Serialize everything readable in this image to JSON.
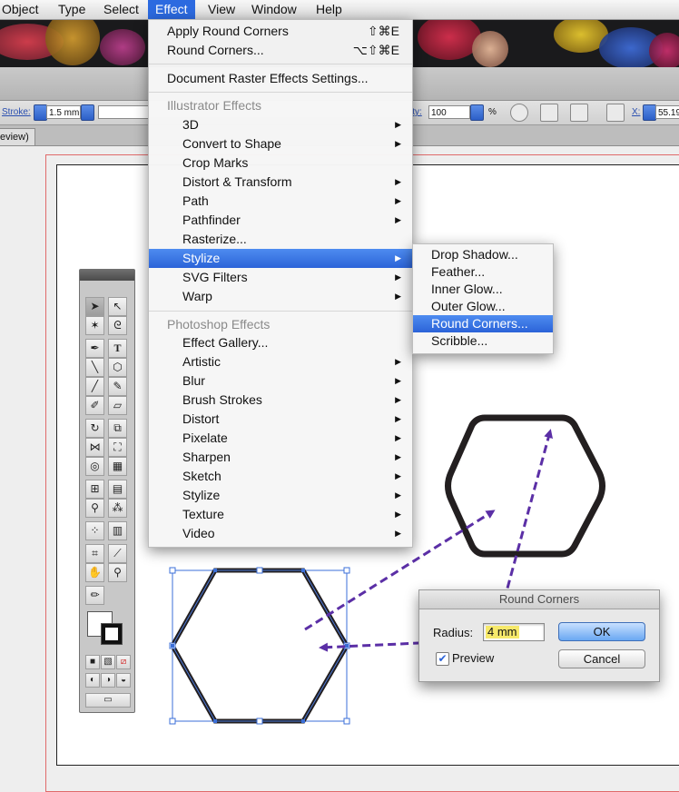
{
  "menubar": {
    "items": [
      "Object",
      "Type",
      "Select",
      "Effect",
      "View",
      "Window",
      "Help"
    ],
    "active": "Effect"
  },
  "control_bar": {
    "stroke_label": "Stroke:",
    "stroke_value": "1.5 mm",
    "opacity_label": "ity:",
    "opacity_value": "100",
    "opacity_unit": "%",
    "x_label": "X:",
    "x_value": "55.19"
  },
  "document_tab": {
    "label": "eview)"
  },
  "effect_menu": {
    "apply_round_corners": {
      "label": "Apply Round Corners",
      "shortcut": "⇧⌘E"
    },
    "round_corners": {
      "label": "Round Corners...",
      "shortcut": "⌥⇧⌘E"
    },
    "document_raster": "Document Raster Effects Settings...",
    "illustrator_header": "Illustrator Effects",
    "illustrator_items": [
      "3D",
      "Convert to Shape",
      "Crop Marks",
      "Distort & Transform",
      "Path",
      "Pathfinder",
      "Rasterize...",
      "Stylize",
      "SVG Filters",
      "Warp"
    ],
    "photoshop_header": "Photoshop Effects",
    "photoshop_items": [
      "Effect Gallery...",
      "Artistic",
      "Blur",
      "Brush Strokes",
      "Distort",
      "Pixelate",
      "Sharpen",
      "Sketch",
      "Stylize",
      "Texture",
      "Video"
    ],
    "highlighted": "Stylize"
  },
  "stylize_submenu": {
    "items": [
      "Drop Shadow...",
      "Feather...",
      "Inner Glow...",
      "Outer Glow...",
      "Round Corners...",
      "Scribble..."
    ],
    "highlighted": "Round Corners..."
  },
  "round_corners_dialog": {
    "title": "Round Corners",
    "radius_label": "Radius:",
    "radius_value": "4 mm",
    "preview_label": "Preview",
    "preview_checked": true,
    "ok_label": "OK",
    "cancel_label": "Cancel"
  },
  "colors": {
    "menu_highlight": "#2b63d8",
    "arrow": "#5b2fa6",
    "artboard_bleed": "#e06a6a",
    "selection": "#3b6fd8"
  }
}
